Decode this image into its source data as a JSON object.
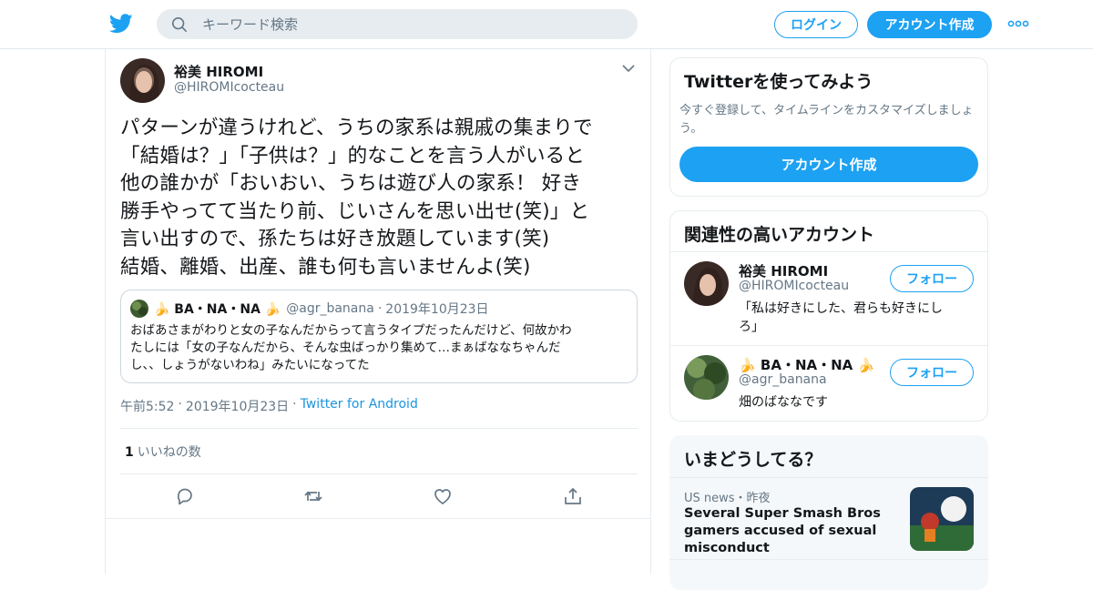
{
  "header": {
    "search_placeholder": "キーワード検索",
    "login_label": "ログイン",
    "signup_label": "アカウント作成"
  },
  "tweet": {
    "author_name": "裕美 HIROMI",
    "author_handle": "@HIROMIcocteau",
    "text": "パターンが違うけれど、うちの家系は親戚の集まりで\n「結婚は？」「子供は？」的なことを言う人がいると\n他の誰かが「おいおい、うちは遊び人の家系！ 好き\n勝手やってて当たり前、じいさんを思い出せ(笑)」と\n言い出すので、孫たちは好き放題しています(笑)\n結婚、離婚、出産、誰も何も言いませんよ(笑)",
    "quote": {
      "name": "🍌 BA・NA・NA 🍌",
      "handle": "@agr_banana",
      "date": "2019年10月23日",
      "text": "おばあさまがわりと女の子なんだからって言うタイプだったんだけど、何故かわ\nたしには「女の子なんだから、そんな虫ばっかり集めて…まぁばななちゃんだ\nし、、しょうがないわね」みたいになってた"
    },
    "time": "午前5:52",
    "date": "2019年10月23日",
    "source": "Twitter for Android",
    "likes_count": "1",
    "likes_label": "いいねの数"
  },
  "sidebar": {
    "signup_card": {
      "title": "Twitterを使ってみよう",
      "description": "今すぐ登録して、タイムラインをカスタマイズしましょう。",
      "button_label": "アカウント作成"
    },
    "related": {
      "title": "関連性の高いアカウント",
      "follow_label": "フォロー",
      "accounts": [
        {
          "name": "裕美 HIROMI",
          "handle": "@HIROMIcocteau",
          "bio": "「私は好きにした、君らも好きにしろ」"
        },
        {
          "name": "🍌 BA・NA・NA 🍌",
          "handle": "@agr_banana",
          "bio": "畑のばななです"
        }
      ]
    },
    "trends": {
      "title": "いまどうしてる？",
      "items": [
        {
          "category": "US news・昨夜",
          "headline": "Several Super Smash Bros gamers accused of sexual misconduct"
        }
      ]
    }
  },
  "colors": {
    "accent": "#1da1f2",
    "text": "#14171a",
    "muted": "#657786",
    "border": "#e6ecf0"
  }
}
